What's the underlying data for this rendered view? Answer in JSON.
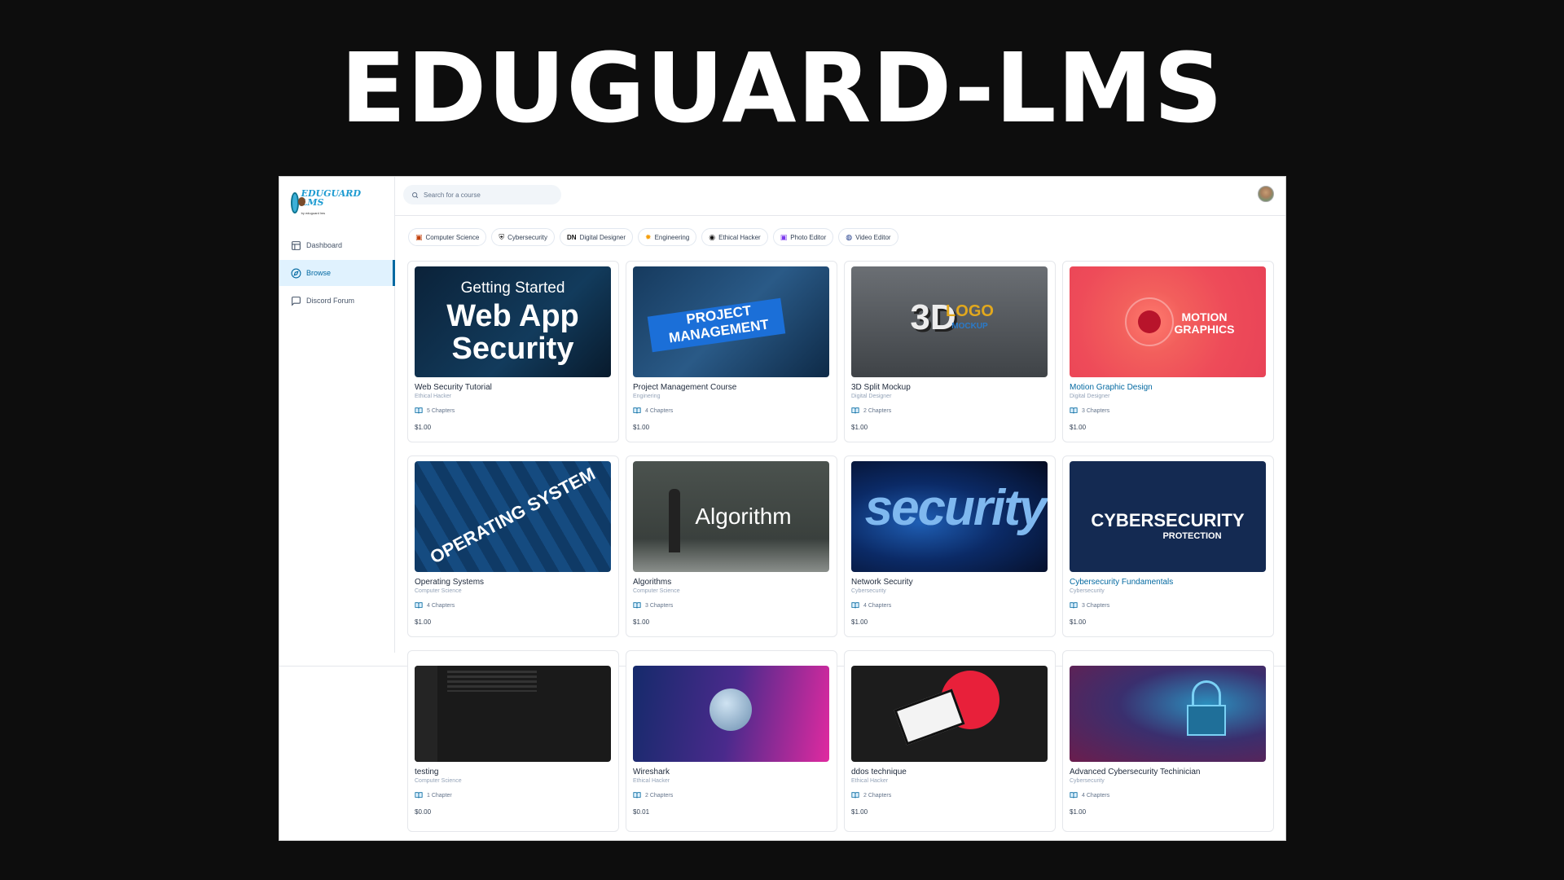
{
  "hero": {
    "title": "EDUGUARD-LMS"
  },
  "app": {
    "logo": {
      "line1": "EDUGUARD",
      "line2": "LMS",
      "sub": "by eduguard lms"
    },
    "search": {
      "placeholder": "Search for a course"
    },
    "nav": [
      {
        "label": "Dashboard",
        "icon": "layout-icon",
        "active": false
      },
      {
        "label": "Browse",
        "icon": "compass-icon",
        "active": true
      },
      {
        "label": "Discord Forum",
        "icon": "message-square-icon",
        "active": false
      }
    ],
    "categories": [
      {
        "label": "Computer Science",
        "icon": "monitor-icon"
      },
      {
        "label": "Cybersecurity",
        "icon": "shield-icon"
      },
      {
        "label": "Digital Designer",
        "icon": "dn-icon",
        "glyph": "DN"
      },
      {
        "label": "Engineering",
        "icon": "gear-icon"
      },
      {
        "label": "Ethical Hacker",
        "icon": "chrome-icon"
      },
      {
        "label": "Photo Editor",
        "icon": "camera-icon"
      },
      {
        "label": "Video Editor",
        "icon": "video-icon"
      }
    ],
    "courses": [
      {
        "title": "Web Security Tutorial",
        "category": "Ethical Hacker",
        "chapters": "5 Chapters",
        "price": "$1.00",
        "thumb_lines": [
          "Getting Started",
          "Web App",
          "Security"
        ],
        "highlight": false
      },
      {
        "title": "Project Management Course",
        "category": "Enginering",
        "chapters": "4 Chapters",
        "price": "$1.00",
        "thumb_lines": [
          "PROJECT",
          "MANAGEMENT"
        ],
        "highlight": false
      },
      {
        "title": "3D Split Mockup",
        "category": "Digital Designer",
        "chapters": "2 Chapters",
        "price": "$1.00",
        "thumb_lines": [
          "3D",
          "LOGO",
          "MOCKUP"
        ],
        "highlight": false
      },
      {
        "title": "Motion Graphic Design",
        "category": "Digital Designer",
        "chapters": "3 Chapters",
        "price": "$1.00",
        "thumb_lines": [
          "MOTION",
          "GRAPHICS"
        ],
        "highlight": true
      },
      {
        "title": "Operating Systems",
        "category": "Computer Science",
        "chapters": "4 Chapters",
        "price": "$1.00",
        "thumb_lines": [
          "OPERATING SYSTEM"
        ],
        "highlight": false
      },
      {
        "title": "Algorithms",
        "category": "Computer Science",
        "chapters": "3 Chapters",
        "price": "$1.00",
        "thumb_lines": [
          "Algorithm"
        ],
        "highlight": false
      },
      {
        "title": "Network Security",
        "category": "Cybersecurity",
        "chapters": "4 Chapters",
        "price": "$1.00",
        "thumb_lines": [
          "security"
        ],
        "highlight": false
      },
      {
        "title": "Cybersecurity Fundamentals",
        "category": "Cybersecurity",
        "chapters": "3 Chapters",
        "price": "$1.00",
        "thumb_lines": [
          "CYBERSECURITY",
          "PROTECTION"
        ],
        "highlight": true
      },
      {
        "title": "testing",
        "category": "Computer Science",
        "chapters": "1 Chapter",
        "price": "$0.00",
        "thumb_lines": [],
        "highlight": false
      },
      {
        "title": "Wireshark",
        "category": "Ethical Hacker",
        "chapters": "2 Chapters",
        "price": "$0.01",
        "thumb_lines": [],
        "highlight": false
      },
      {
        "title": "ddos technique",
        "category": "Ethical Hacker",
        "chapters": "2 Chapters",
        "price": "$1.00",
        "thumb_lines": [],
        "highlight": false
      },
      {
        "title": "Advanced Cybersecurity Techinician",
        "category": "Cybersecurity",
        "chapters": "4 Chapters",
        "price": "$1.00",
        "thumb_lines": [],
        "highlight": false
      }
    ]
  },
  "colors": {
    "accent": "#0369a1",
    "background": "#0d0d0d"
  }
}
